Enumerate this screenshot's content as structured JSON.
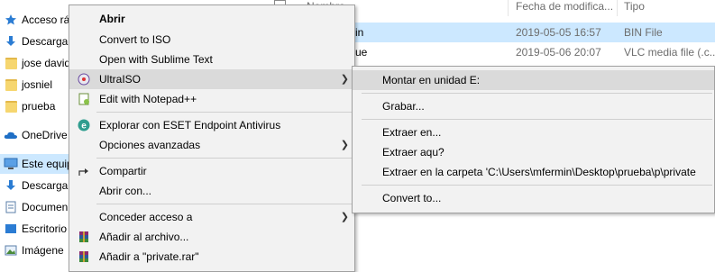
{
  "nav": {
    "items": [
      {
        "label": "Acceso ráp",
        "icon": "star-icon"
      },
      {
        "label": "Descarga",
        "icon": "download-arrow-icon"
      },
      {
        "label": "jose david",
        "icon": "folder-icon"
      },
      {
        "label": "josniel",
        "icon": "folder-icon"
      },
      {
        "label": "prueba",
        "icon": "folder-icon"
      },
      {
        "label": "OneDrive",
        "icon": "cloud-icon"
      },
      {
        "label": "Este equip",
        "icon": "computer-icon"
      },
      {
        "label": "Descarga",
        "icon": "download-arrow-icon"
      },
      {
        "label": "Documen",
        "icon": "documents-icon"
      },
      {
        "label": "Escritorio",
        "icon": "desktop-icon"
      },
      {
        "label": "Imágene",
        "icon": "pictures-icon"
      }
    ]
  },
  "files": {
    "headers": {
      "name": "Nombre",
      "date": "Fecha de modifica...",
      "type": "Tipo"
    },
    "rows": [
      {
        "name": "in",
        "date": "2019-05-05 16:57",
        "type": "BIN File"
      },
      {
        "name": "ue",
        "date": "2019-05-06 20:07",
        "type": "VLC media file (.c..."
      }
    ]
  },
  "context_menu": {
    "open": "Abrir",
    "convert_iso": "Convert to ISO",
    "sublime": "Open with Sublime Text",
    "ultraiso": "UltraISO",
    "notepad": "Edit with Notepad++",
    "eset": "Explorar con ESET Endpoint Antivirus",
    "advanced": "Opciones avanzadas",
    "share": "Compartir",
    "open_with": "Abrir con...",
    "grant_access": "Conceder acceso a",
    "add_archive": "Añadir al archivo...",
    "add_rar": "Añadir a \"private.rar\""
  },
  "submenu": {
    "mount": "Montar en unidad E:",
    "burn": "Grabar...",
    "extract_to": "Extraer en...",
    "extract_here": "Extraer aqu?",
    "extract_folder": "Extraer en la carpeta 'C:\\Users\\mfermin\\Desktop\\prueba\\p\\private",
    "convert_to": "Convert to..."
  },
  "colors": {
    "menu_bg": "#f2f2f2",
    "highlight": "#dadada",
    "selection": "#cce8ff",
    "eset_green": "#2f9d8f",
    "accent_blue": "#2b7cd3"
  }
}
